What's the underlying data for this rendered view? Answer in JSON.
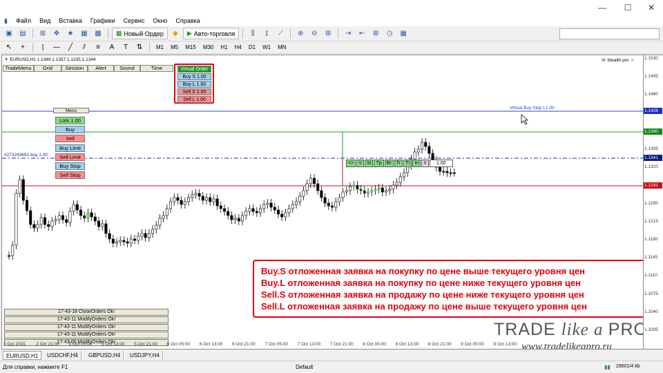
{
  "window": {
    "menu": [
      "Файл",
      "Вид",
      "Вставка",
      "Графики",
      "Сервис",
      "Окно",
      "Справка"
    ],
    "controls": {
      "minimize": "—",
      "maximize": "☐",
      "close": "✕"
    }
  },
  "toolbar": {
    "new_order": "Новый Ордер",
    "auto_trading": "Авто-торговля",
    "timeframes": [
      "M1",
      "M5",
      "M15",
      "M30",
      "H1",
      "H4",
      "D1",
      "W1",
      "MN"
    ]
  },
  "chart": {
    "header": "EURUSD,H1  1.1349 1.1357 1.1335 1.1344",
    "stealth_label": "Vr Stealth pro",
    "tab_buttons": [
      "TradeMenu",
      "Grid",
      "Session",
      "Alert",
      "Sound",
      "Time"
    ],
    "virtual_order": {
      "title": "Virtual Order",
      "rows": [
        "Buy S 1.00",
        "Buy L 1.00",
        "Sell S 1.00",
        "Sell L 1.00"
      ]
    },
    "menu_panel": {
      "title": "Menu",
      "rows": [
        "Lots 1.00",
        "Buy",
        "Sell",
        "Buy Limit",
        "Sell Limit",
        "Buy Stop",
        "Sell Stop"
      ]
    },
    "virtual_buy_stop_label": "Virtual Buy Stop L1.00",
    "order_label": "#273243692 buy 1.00",
    "order_controls": [
      "<>",
      "V",
      "SI",
      "Tp",
      "Br",
      "Tr",
      "TI",
      "In",
      "X",
      "1.00"
    ],
    "price_ticks": [
      "1.1530",
      "1.1495",
      "1.1460",
      "1.1425",
      "1.1390",
      "1.1355",
      "1.1320",
      "1.1285",
      "1.1250",
      "1.1215",
      "1.1180",
      "1.1145",
      "1.1110",
      "1.1075",
      "1.1040",
      "1.1005"
    ],
    "price_tags": [
      {
        "label": "1.1428",
        "color": "#1c2bcc"
      },
      {
        "label": "1.1390",
        "color": "#118a11"
      },
      {
        "label": "1.1341",
        "color": "#0a1f80"
      },
      {
        "label": "1.1291",
        "color": "#c0101c"
      }
    ],
    "time_labels": [
      "2 Oct 2015",
      "2 Oct 21:00",
      "5 Oct 05:00",
      "5 Oct 13:00",
      "5 Oct 21:00",
      "6 Oct 05:00",
      "6 Oct 13:00",
      "6 Oct 21:00",
      "7 Oct 05:00",
      "7 Oct 13:00",
      "7 Oct 21:00",
      "8 Oct 05:00",
      "8 Oct 13:00",
      "8 Oct 21:00",
      "9 Oct 05:00",
      "9 Oct 13:00"
    ],
    "order_log": [
      "17-43-18 CloseOrders Ok!",
      "17-43-11 ModifyOrders Ok!",
      "17-43-11 ModifyOrders Ok!",
      "17-43-11 ModifyOrders Ok!",
      "17-43-00 ModifyOrders Ok!"
    ],
    "info_lines": [
      {
        "term": "Buy.S",
        "text": " отложенная заявка на покупку по цене выше текущего уровня цен"
      },
      {
        "term": "Buy.L",
        "text": " отложенная заявка на покупку по цене ниже текущего уровня цен"
      },
      {
        "term": "Sell.S",
        "text": " отложенная заявка на продажу по цене ниже текущего уровня цен"
      },
      {
        "term": "Sell.L",
        "text": " отложенная заявка на продажу по цене выше текущего уровня цен"
      }
    ],
    "logo": {
      "left": "TRADE ",
      "mid": "like a ",
      "right": "PRO"
    },
    "url": "www.tradelikeapro.ru"
  },
  "tabs": [
    "EURUSD,H1",
    "USDCHF,H4",
    "GBPUSD,H4",
    "USDJPY,H4"
  ],
  "status": {
    "help": "Для справки, нажмите F1",
    "profile": "Default",
    "traffic": "29601/4 kb"
  },
  "colors": {
    "accent_red": "#e0000c",
    "buy_green": "#7fe07f",
    "sell_red": "#ff8c8c",
    "buy_blue": "#9fd0f0"
  }
}
